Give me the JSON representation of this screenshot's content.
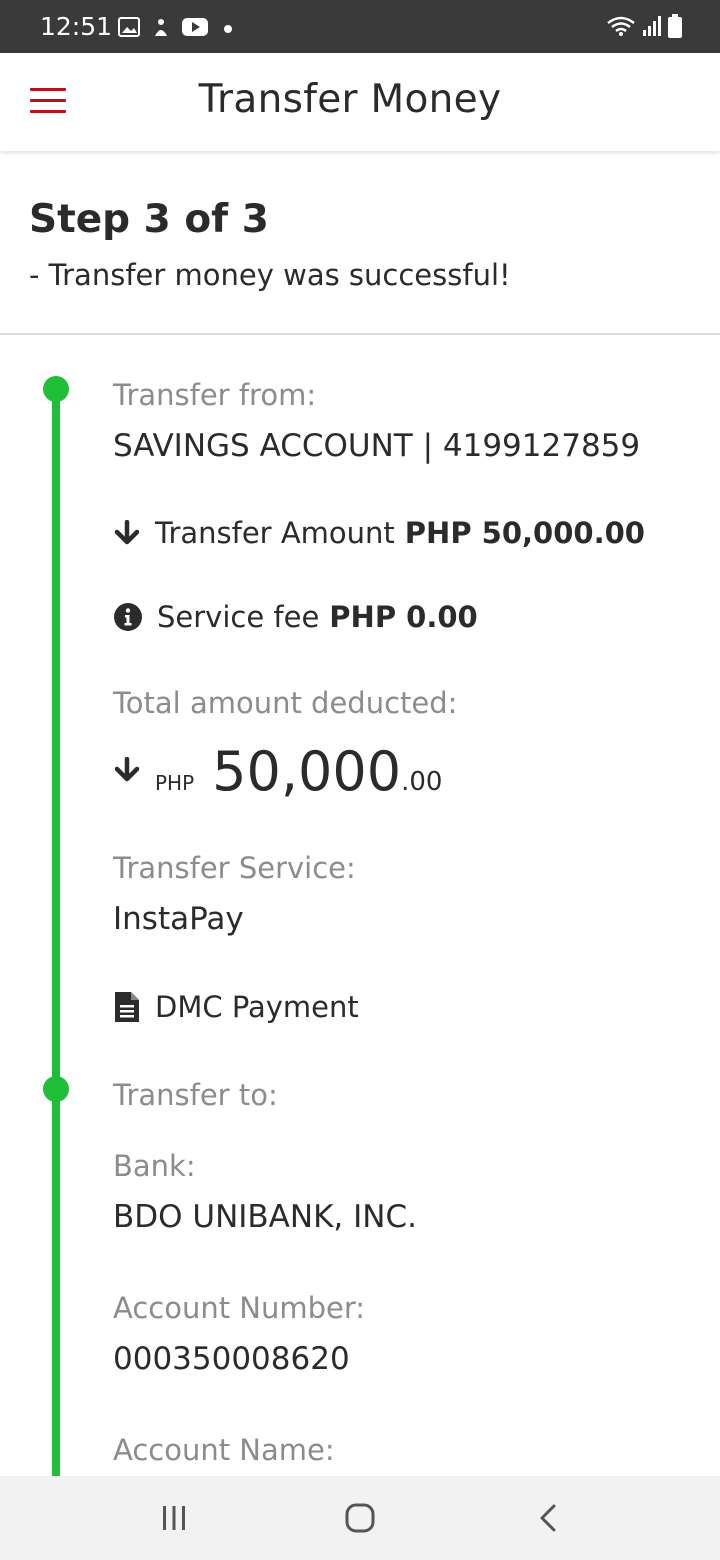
{
  "status_bar": {
    "time": "12:51"
  },
  "app_bar": {
    "title": "Transfer Money"
  },
  "step": {
    "title": "Step 3 of 3",
    "subtitle": "- Transfer money was successful!"
  },
  "transfer_from": {
    "label": "Transfer from:",
    "value": "SAVINGS ACCOUNT | 4199127859"
  },
  "transfer_amount": {
    "label": "Transfer Amount",
    "value": "PHP  50,000.00"
  },
  "service_fee": {
    "label": "Service fee",
    "value": "PHP  0.00"
  },
  "total_deducted": {
    "label": "Total amount deducted:",
    "currency": "PHP",
    "amount_main": "50,000",
    "amount_cents": ".00"
  },
  "transfer_service": {
    "label": "Transfer Service:",
    "value": "InstaPay"
  },
  "purpose": {
    "value": "DMC Payment"
  },
  "transfer_to": {
    "label": "Transfer to:"
  },
  "bank": {
    "label": "Bank:",
    "value": "BDO UNIBANK, INC."
  },
  "account_number": {
    "label": "Account Number:",
    "value": "000350008620"
  },
  "account_name": {
    "label": "Account Name:"
  },
  "colors": {
    "accent_red": "#b5121b",
    "timeline_green": "#1fbf3a",
    "status_bar": "#3a3a3a"
  },
  "icons": {
    "amount": "arrow-down-icon",
    "fee": "info-circle-icon",
    "purpose": "document-icon"
  }
}
